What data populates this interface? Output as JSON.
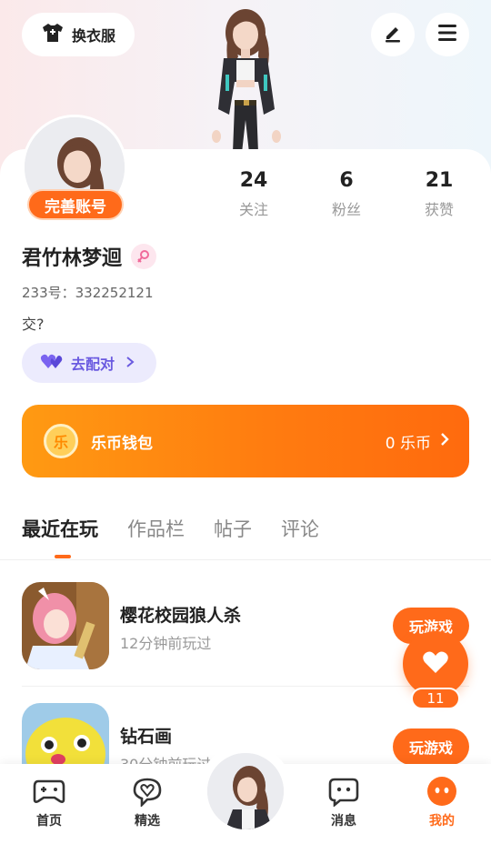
{
  "header": {
    "wardrobe_label": "换衣服"
  },
  "profile": {
    "complete_badge": "完善账号",
    "stats": [
      {
        "value": "24",
        "label": "关注"
      },
      {
        "value": "6",
        "label": "粉丝"
      },
      {
        "value": "21",
        "label": "获赞"
      }
    ],
    "username": "君竹林梦迴",
    "uid": "233号：332252121",
    "bio": "交?",
    "match_label": "去配对"
  },
  "wallet": {
    "coin_glyph": "乐",
    "title": "乐币钱包",
    "amount": "0 乐币"
  },
  "tabs": [
    "最近在玩",
    "作品栏",
    "帖子",
    "评论"
  ],
  "games": [
    {
      "name": "樱花校园狼人杀",
      "time": "12分钟前玩过",
      "action": "玩游戏"
    },
    {
      "name": "钻石画",
      "time": "30分钟前玩过",
      "action": "玩游戏"
    }
  ],
  "like_float": {
    "count": "11"
  },
  "nav": [
    {
      "label": "首页",
      "icon": "gamepad-icon"
    },
    {
      "label": "精选",
      "icon": "heart-chat-icon"
    },
    {
      "label": "消息",
      "icon": "message-icon"
    },
    {
      "label": "我的",
      "icon": "profile-face-icon"
    }
  ],
  "colors": {
    "accent": "#ff6a1a",
    "purple": "#6a5ae0",
    "wallet_start": "#ff9a12",
    "wallet_end": "#ff6a0e"
  }
}
